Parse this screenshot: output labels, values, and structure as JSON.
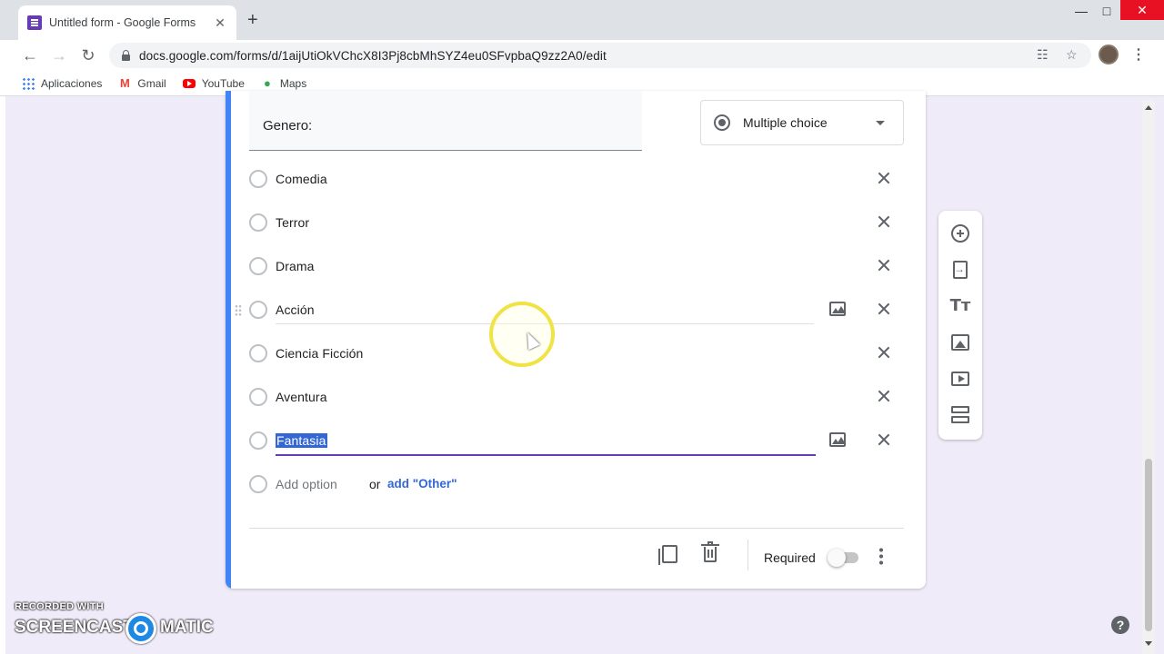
{
  "browser": {
    "tab_title": "Untitled form - Google Forms",
    "tab_close": "✕",
    "new_tab": "+",
    "url": "docs.google.com/forms/d/1aijUtiOkVChcX8I3Pj8cbMhSYZ4eu0SFvpbaQ9zz2A0/edit",
    "bookmarks": [
      {
        "label": "Aplicaciones",
        "icon": "apps-grid-icon"
      },
      {
        "label": "Gmail",
        "icon": "gmail-icon"
      },
      {
        "label": "YouTube",
        "icon": "youtube-icon"
      },
      {
        "label": "Maps",
        "icon": "maps-icon"
      }
    ]
  },
  "question": {
    "title": "Genero:",
    "type": "Multiple choice",
    "options": [
      {
        "label": "Comedia"
      },
      {
        "label": "Terror"
      },
      {
        "label": "Drama"
      },
      {
        "label": "Acción"
      },
      {
        "label": "Ciencia Ficción"
      },
      {
        "label": "Aventura"
      },
      {
        "label": "Fantasia"
      }
    ],
    "add_option": "Add option",
    "or_text": "or",
    "add_other": "add \"Other\"",
    "required_label": "Required",
    "required": false
  },
  "side_toolbar": [
    "add-question-icon",
    "import-questions-icon",
    "add-title-icon",
    "add-image-icon",
    "add-video-icon",
    "add-section-icon"
  ],
  "colors": {
    "accent": "#4285f4",
    "theme": "#673ab7",
    "background": "#f0ebf8"
  },
  "help": "?",
  "watermark": {
    "top": "RECORDED WITH",
    "left": "SCREENCAST",
    "right": "MATIC"
  }
}
